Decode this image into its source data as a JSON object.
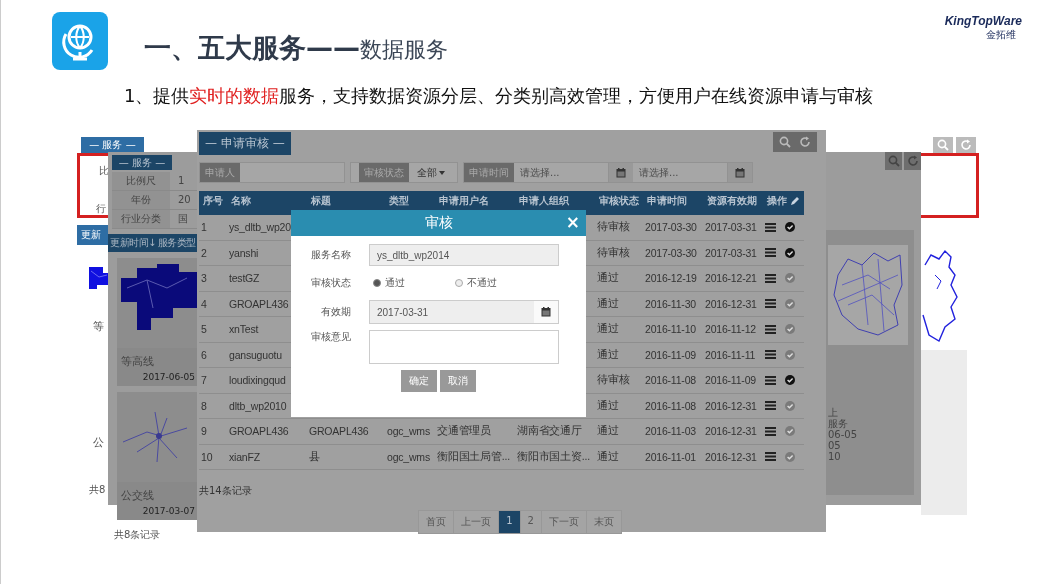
{
  "header": {
    "title": "**一、五大服务——**数据服务",
    "logo_name": "KingTopWare",
    "logo_cn": "金拓维"
  },
  "subtitle": [
    {
      "text": "1、提供",
      "highlight": false
    },
    {
      "text": "实时的数据",
      "highlight": true
    },
    {
      "text": "服务，支持数据资源分层、分类别高效管理，方便用户在线资源申请与审核",
      "highlight": false
    }
  ],
  "back_window": {
    "tab": "— 服务 —",
    "fragments": [
      "比",
      "行"
    ],
    "toolbar": "更新",
    "cards": [
      "等",
      "公"
    ],
    "count": "共8"
  },
  "middle_window": {
    "tab": "— 服务 —",
    "fields": [
      {
        "label": "比例尺",
        "value": "1"
      },
      {
        "label": "年份",
        "value": "20"
      },
      {
        "label": "行业分类",
        "value": "国"
      }
    ],
    "toolbar": [
      "更新时间↓",
      "服务类型"
    ],
    "cards": [
      {
        "name": "等高线",
        "date": "2017-06-05"
      },
      {
        "name": "公交线",
        "date": "2017-03-07"
      }
    ],
    "count": "共8条记录",
    "right_fragments": [
      "上",
      "服务",
      "06-05",
      "05",
      "10"
    ]
  },
  "review": {
    "tab": "— 申请审核 —",
    "filters": [
      {
        "label": "申请人",
        "kind": "text"
      },
      {
        "label": "审核状态",
        "kind": "select",
        "value": "全部"
      },
      {
        "label": "申请时间",
        "kind": "dates",
        "placeholders": [
          "请选择...",
          "请选择..."
        ]
      }
    ],
    "columns": [
      "序号",
      "名称",
      "标题",
      "类型",
      "申请用户名",
      "申请人组织",
      "审核状态",
      "申请时间",
      "资源有效期",
      "操作"
    ],
    "rows": [
      {
        "number": "1",
        "name": "ys_dltb_wp20",
        "status": "待审核",
        "applied": "2017-03-30",
        "valid": "2017-03-31",
        "pending": true
      },
      {
        "number": "2",
        "name": "yanshi",
        "status": "待审核",
        "applied": "2017-03-30",
        "valid": "2017-03-31",
        "pending": true
      },
      {
        "number": "3",
        "name": "testGZ",
        "status": "通过",
        "applied": "2016-12-19",
        "valid": "2016-12-21",
        "pending": false
      },
      {
        "number": "4",
        "name": "GROAPL436",
        "status": "通过",
        "applied": "2016-11-30",
        "valid": "2016-12-31",
        "pending": false
      },
      {
        "number": "5",
        "name": "xnTest",
        "status": "通过",
        "applied": "2016-11-10",
        "valid": "2016-11-12",
        "pending": false
      },
      {
        "number": "6",
        "name": "gansuguotu",
        "status": "通过",
        "applied": "2016-11-09",
        "valid": "2016-11-11",
        "pending": false
      },
      {
        "number": "7",
        "name": "loudixingqud",
        "status": "待审核",
        "applied": "2016-11-08",
        "valid": "2016-11-09",
        "pending": true
      },
      {
        "number": "8",
        "name": "dltb_wp2010",
        "status": "通过",
        "applied": "2016-11-08",
        "valid": "2016-12-31",
        "pending": false
      },
      {
        "number": "9",
        "name": "GROAPL436",
        "title": "GROAPL436",
        "type": "ogc_wms",
        "user": "交通管理员",
        "org": "湖南省交通厅",
        "status": "通过",
        "applied": "2016-11-03",
        "valid": "2016-12-31",
        "pending": false
      },
      {
        "number": "10",
        "name": "xianFZ",
        "title": "县",
        "type": "ogc_wms",
        "user": "衡阳国土局管...",
        "org": "衡阳市国土资...",
        "status": "通过",
        "applied": "2016-11-01",
        "valid": "2016-12-31",
        "pending": false
      }
    ],
    "total": "共14条记录",
    "pages": [
      {
        "label": "首页",
        "selected": false
      },
      {
        "label": "上一页",
        "selected": false
      },
      {
        "label": "1",
        "selected": true
      },
      {
        "label": "2",
        "selected": false
      },
      {
        "label": "下一页",
        "selected": false
      },
      {
        "label": "末页",
        "selected": false
      }
    ]
  },
  "dialog": {
    "title": "审核",
    "close": "×",
    "service_label": "服务名称",
    "service_value": "ys_dltb_wp2014",
    "status_label": "审核状态",
    "options": [
      {
        "label": "通过",
        "selected": true
      },
      {
        "label": "不通过",
        "selected": false
      }
    ],
    "validity_label": "有效期",
    "validity_value": "2017-03-31",
    "opinion_label": "审核意见",
    "buttons": [
      "确定",
      "取消"
    ]
  }
}
